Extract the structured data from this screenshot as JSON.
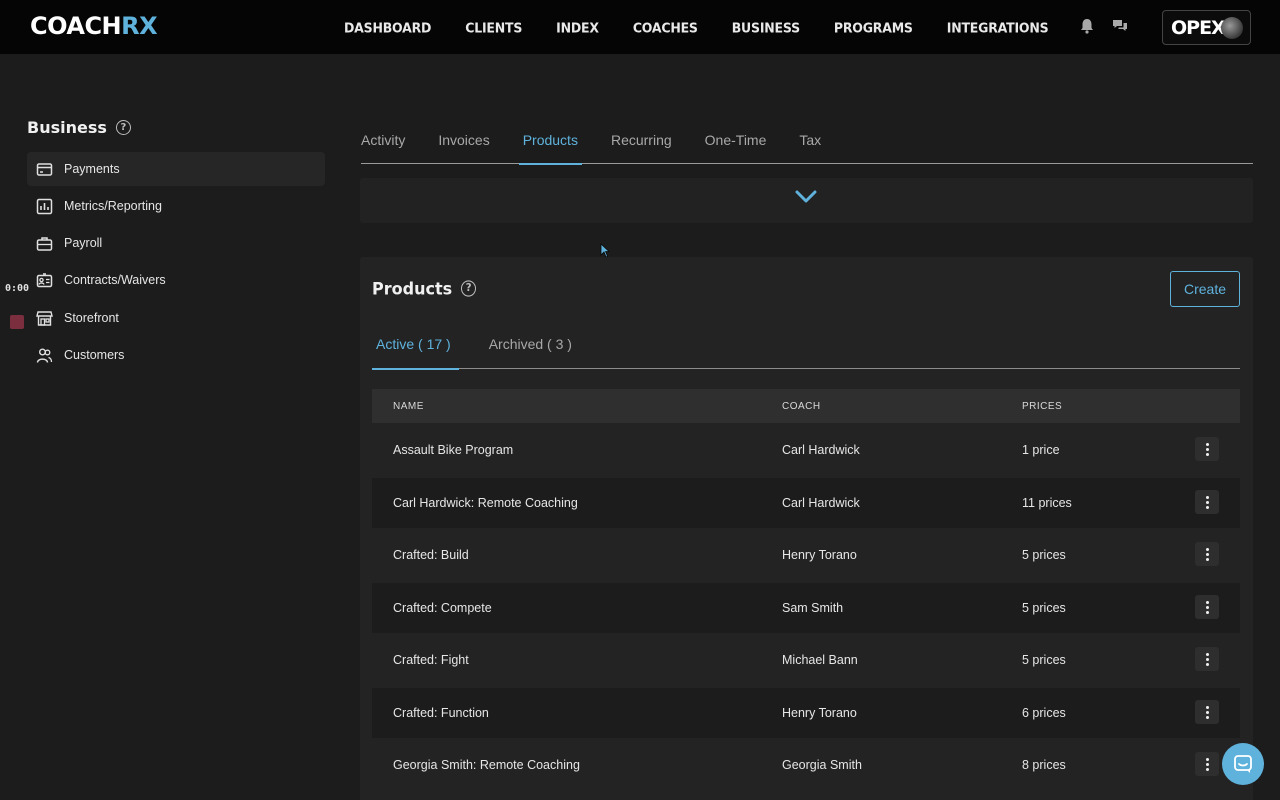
{
  "app": {
    "logo_main": "COACH",
    "logo_accent": "RX",
    "nav": [
      "DASHBOARD",
      "CLIENTS",
      "INDEX",
      "COACHES",
      "BUSINESS",
      "PROGRAMS",
      "INTEGRATIONS"
    ],
    "org_name": "OPEX"
  },
  "sidebar": {
    "title": "Business",
    "items": [
      {
        "label": "Payments",
        "icon": "credit-card-icon"
      },
      {
        "label": "Metrics/Reporting",
        "icon": "bar-chart-icon"
      },
      {
        "label": "Payroll",
        "icon": "briefcase-icon"
      },
      {
        "label": "Contracts/Waivers",
        "icon": "id-card-icon"
      },
      {
        "label": "Storefront",
        "icon": "store-icon"
      },
      {
        "label": "Customers",
        "icon": "users-icon"
      }
    ]
  },
  "overlay": {
    "timestamp": "0:00"
  },
  "tabs": [
    "Activity",
    "Invoices",
    "Products",
    "Recurring",
    "One-Time",
    "Tax"
  ],
  "products": {
    "title": "Products",
    "create_label": "Create",
    "subtabs": [
      "Active ( 17 )",
      "Archived ( 3 )"
    ],
    "columns": [
      "NAME",
      "COACH",
      "PRICES"
    ],
    "rows": [
      {
        "name": "Assault Bike Program",
        "coach": "Carl Hardwick",
        "prices": "1 price"
      },
      {
        "name": "Carl Hardwick: Remote Coaching",
        "coach": "Carl Hardwick",
        "prices": "11 prices"
      },
      {
        "name": "Crafted: Build",
        "coach": "Henry Torano",
        "prices": "5 prices"
      },
      {
        "name": "Crafted: Compete",
        "coach": "Sam Smith",
        "prices": "5 prices"
      },
      {
        "name": "Crafted: Fight",
        "coach": "Michael Bann",
        "prices": "5 prices"
      },
      {
        "name": "Crafted: Function",
        "coach": "Henry Torano",
        "prices": "6 prices"
      },
      {
        "name": "Georgia Smith: Remote Coaching",
        "coach": "Georgia Smith",
        "prices": "8 prices"
      }
    ]
  },
  "colors": {
    "accent": "#5fb2dc",
    "background": "#1c1c1c",
    "topbar": "#050505"
  }
}
